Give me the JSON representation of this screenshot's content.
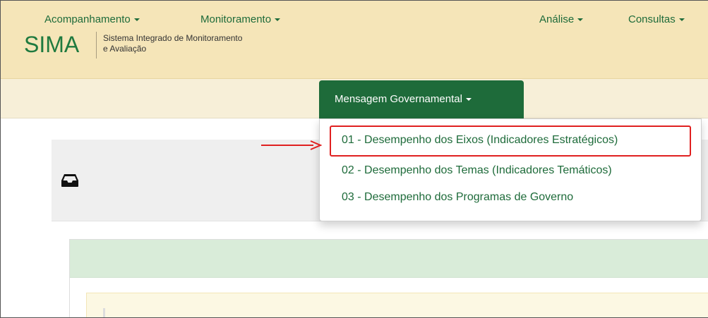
{
  "header": {
    "logo": "SIMA",
    "subtitle_line1": "Sistema Integrado de Monitoramento",
    "subtitle_line2": "e Avaliação"
  },
  "nav": {
    "items": [
      {
        "label": "Acompanhamento"
      },
      {
        "label": "Monitoramento"
      },
      {
        "label": "Mensagem Governamental"
      },
      {
        "label": "Análise"
      },
      {
        "label": "Consultas"
      }
    ],
    "active_index": 2
  },
  "dropdown": {
    "items": [
      {
        "label": "01 - Desempenho dos Eixos (Indicadores Estratégicos)",
        "highlighted": true
      },
      {
        "label": "02 - Desempenho dos Temas (Indicadores Temáticos)"
      },
      {
        "label": "03 - Desempenho dos Programas de Governo"
      }
    ]
  },
  "panel": {
    "icon": "inbox-icon"
  },
  "colors": {
    "brand_green": "#1e6b3a",
    "header_bg": "#f5e5b8",
    "nav_bg": "#f7efd8",
    "highlight_red": "#e02020"
  }
}
